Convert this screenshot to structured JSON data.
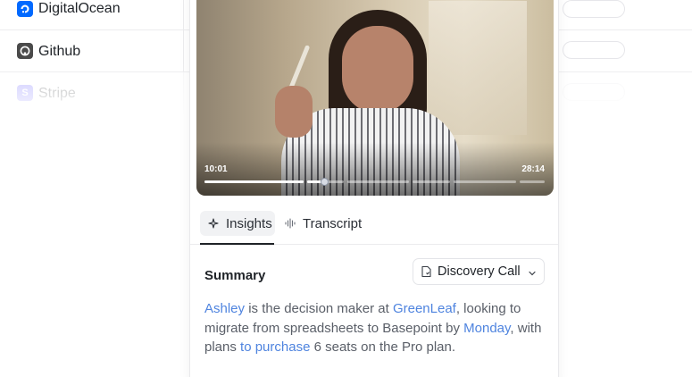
{
  "integrations": [
    {
      "name": "DigitalOcean",
      "logo_icon": "digitalocean-logo-icon",
      "logo_color": "#0069ff"
    },
    {
      "name": "Github",
      "logo_icon": "github-logo-icon",
      "logo_color": "#4a4a4a"
    },
    {
      "name": "Stripe",
      "logo_icon": "stripe-logo-icon",
      "logo_color": "#635bff",
      "logo_letter": "S"
    }
  ],
  "player": {
    "current_time": "10:01",
    "total_time": "28:14",
    "progress_fraction": 0.355
  },
  "tabs": [
    {
      "label": "Insights",
      "icon": "sparkle-icon",
      "active": true
    },
    {
      "label": "Transcript",
      "icon": "waveform-icon",
      "active": false
    }
  ],
  "summary": {
    "title": "Summary",
    "call_type": "Discovery Call",
    "text": {
      "person": "Ashley",
      "p1": " is the decision maker at ",
      "company": "GreenLeaf",
      "p2": ", looking to migrate from spreadsheets to Basepoint by ",
      "day": "Monday",
      "p3": ", with plans ",
      "intent": "to purchase",
      "p4": " 6 seats on the Pro plan."
    }
  },
  "colors": {
    "accent_link": "#4f84df",
    "body_text": "#5a5f68"
  }
}
